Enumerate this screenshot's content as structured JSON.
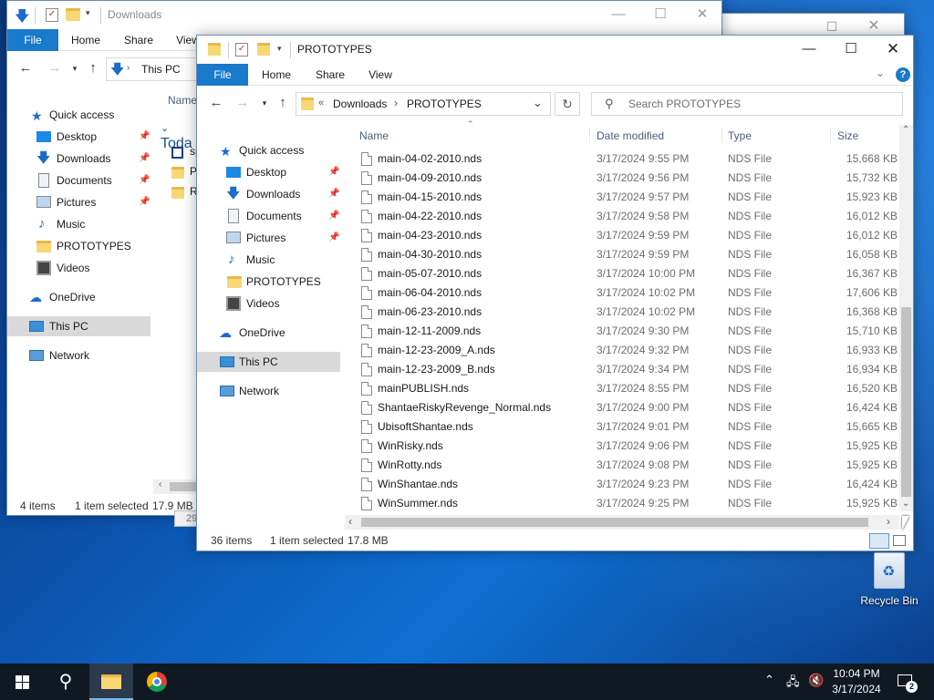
{
  "back_window": {
    "title": "Downloads",
    "tabs": [
      "File",
      "Home",
      "Share",
      "View"
    ],
    "address": [
      "This PC"
    ],
    "column_name": "Name",
    "group_header": "Toda",
    "nav_items": [
      "Quick access",
      "Desktop",
      "Downloads",
      "Documents",
      "Pictures",
      "Music",
      "PROTOTYPES",
      "Videos",
      "OneDrive",
      "This PC",
      "Network"
    ],
    "files": [
      "sp",
      "PF",
      "Ri"
    ],
    "status_items": "4 items",
    "status_selected": "1 item selected",
    "status_size": "17.9 MB",
    "partial_text": "29"
  },
  "front_window": {
    "title": "PROTOTYPES",
    "tabs": [
      "File",
      "Home",
      "Share",
      "View"
    ],
    "address_prefix": "«",
    "address": [
      "Downloads",
      "PROTOTYPES"
    ],
    "search_placeholder": "Search PROTOTYPES",
    "columns": {
      "name": "Name",
      "date": "Date modified",
      "type": "Type",
      "size": "Size"
    },
    "nav_items": [
      "Quick access",
      "Desktop",
      "Downloads",
      "Documents",
      "Pictures",
      "Music",
      "PROTOTYPES",
      "Videos",
      "OneDrive",
      "This PC",
      "Network"
    ],
    "files": [
      {
        "name": "main-04-02-2010.nds",
        "date": "3/17/2024 9:55 PM",
        "type": "NDS File",
        "size": "15,668 KB"
      },
      {
        "name": "main-04-09-2010.nds",
        "date": "3/17/2024 9:56 PM",
        "type": "NDS File",
        "size": "15,732 KB"
      },
      {
        "name": "main-04-15-2010.nds",
        "date": "3/17/2024 9:57 PM",
        "type": "NDS File",
        "size": "15,923 KB"
      },
      {
        "name": "main-04-22-2010.nds",
        "date": "3/17/2024 9:58 PM",
        "type": "NDS File",
        "size": "16,012 KB"
      },
      {
        "name": "main-04-23-2010.nds",
        "date": "3/17/2024 9:59 PM",
        "type": "NDS File",
        "size": "16,012 KB"
      },
      {
        "name": "main-04-30-2010.nds",
        "date": "3/17/2024 9:59 PM",
        "type": "NDS File",
        "size": "16,058 KB"
      },
      {
        "name": "main-05-07-2010.nds",
        "date": "3/17/2024 10:00 PM",
        "type": "NDS File",
        "size": "16,367 KB"
      },
      {
        "name": "main-06-04-2010.nds",
        "date": "3/17/2024 10:02 PM",
        "type": "NDS File",
        "size": "17,606 KB"
      },
      {
        "name": "main-06-23-2010.nds",
        "date": "3/17/2024 10:02 PM",
        "type": "NDS File",
        "size": "16,368 KB"
      },
      {
        "name": "main-12-11-2009.nds",
        "date": "3/17/2024 9:30 PM",
        "type": "NDS File",
        "size": "15,710 KB"
      },
      {
        "name": "main-12-23-2009_A.nds",
        "date": "3/17/2024 9:32 PM",
        "type": "NDS File",
        "size": "16,933 KB"
      },
      {
        "name": "main-12-23-2009_B.nds",
        "date": "3/17/2024 9:34 PM",
        "type": "NDS File",
        "size": "16,934 KB"
      },
      {
        "name": "mainPUBLISH.nds",
        "date": "3/17/2024 8:55 PM",
        "type": "NDS File",
        "size": "16,520 KB"
      },
      {
        "name": "ShantaeRiskyRevenge_Normal.nds",
        "date": "3/17/2024 9:00 PM",
        "type": "NDS File",
        "size": "16,424 KB"
      },
      {
        "name": "UbisoftShantae.nds",
        "date": "3/17/2024 9:01 PM",
        "type": "NDS File",
        "size": "15,665 KB"
      },
      {
        "name": "WinRisky.nds",
        "date": "3/17/2024 9:06 PM",
        "type": "NDS File",
        "size": "15,925 KB"
      },
      {
        "name": "WinRotty.nds",
        "date": "3/17/2024 9:08 PM",
        "type": "NDS File",
        "size": "15,925 KB"
      },
      {
        "name": "WinShantae.nds",
        "date": "3/17/2024 9:23 PM",
        "type": "NDS File",
        "size": "16,424 KB"
      },
      {
        "name": "WinSummer.nds",
        "date": "3/17/2024 9:25 PM",
        "type": "NDS File",
        "size": "15,925 KB"
      }
    ],
    "status_items": "36 items",
    "status_selected": "1 item selected",
    "status_size": "17.8 MB"
  },
  "desktop": {
    "recycle_bin_label": "Recycle Bin"
  },
  "taskbar": {
    "time": "10:04 PM",
    "date": "3/17/2024",
    "notification_count": "2"
  },
  "colors": {
    "accent": "#1979ca",
    "selection": "#d9d9d9",
    "taskbar": "#101822"
  }
}
